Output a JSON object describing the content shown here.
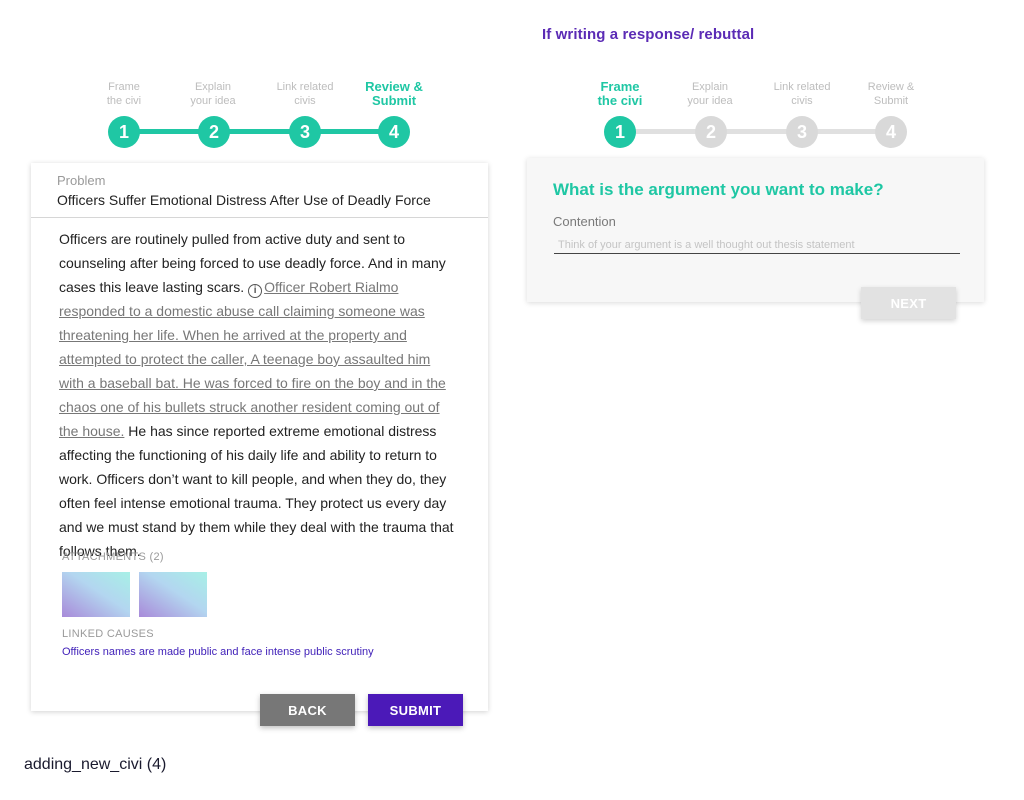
{
  "subtitle": "If writing a response/ rebuttal",
  "left_stepper": {
    "steps": [
      {
        "line1": "Frame",
        "line2": "the civi",
        "number": "1"
      },
      {
        "line1": "Explain",
        "line2": "your idea",
        "number": "2"
      },
      {
        "line1": "Link related",
        "line2": "civis",
        "number": "3"
      },
      {
        "line1": "Review &",
        "line2": "Submit",
        "number": "4"
      }
    ],
    "active_step": 4,
    "colors": {
      "active": "#1fc7a4",
      "inactive": "#bdbdbd"
    }
  },
  "right_stepper": {
    "steps": [
      {
        "line1": "Frame",
        "line2": "the civi",
        "number": "1"
      },
      {
        "line1": "Explain",
        "line2": "your idea",
        "number": "2"
      },
      {
        "line1": "Link related",
        "line2": "civis",
        "number": "3"
      },
      {
        "line1": "Review &",
        "line2": "Submit",
        "number": "4"
      }
    ],
    "active_step": 1
  },
  "review_card": {
    "problem_label": "Problem",
    "problem_title": "Officers Suffer Emotional Distress After Use of Deadly Force",
    "body_intro": "Officers are routinely pulled from active duty and sent to counseling after being forced to use deadly force. And in many cases this leave lasting scars.",
    "info_icon": "i",
    "body_quote": "Officer Robert Rialmo responded to a domestic abuse call claiming someone was threatening her life. When he arrived at the property and attempted to protect the caller, A teenage boy assaulted him with a baseball bat. He was forced to fire on the boy and in the chaos one of his bullets struck another resident coming out of the house.",
    "body_outro": "He has since reported extreme emotional distress affecting the functioning of his daily life and ability to return to work. Officers don’t want to kill people, and when they do, they often feel intense emotional trauma. They protect us every day and we must stand by them while they deal with the trauma that follows them.",
    "attachments_label": "ATTACHMENTS (2)",
    "linked_causes_label": "LINKED CAUSES",
    "linked_cause": "Officers names are made public and face intense public scrutiny",
    "back_label": "BACK",
    "submit_label": "SUBMIT"
  },
  "argument_card": {
    "question": "What is the argument you want to make?",
    "contention_label": "Contention",
    "contention_value": "",
    "contention_placeholder": "Think of your argument is a well thought out thesis statement",
    "next_label": "NEXT"
  },
  "footer_label": "adding_new_civi (4)",
  "colors": {
    "accent_green": "#1fc7a4",
    "accent_purple": "#4b19b8",
    "back_grey": "#777777"
  }
}
